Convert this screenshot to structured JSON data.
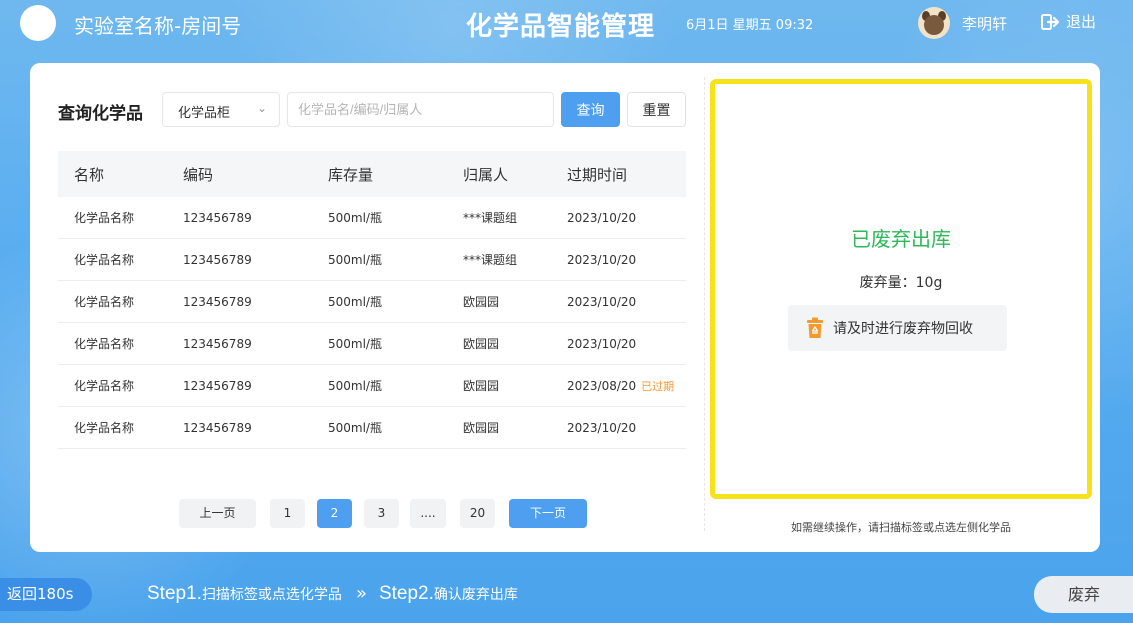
{
  "header": {
    "lab_name": "实验室名称-房间号",
    "title": "化学品智能管理",
    "datetime": "6月1日  星期五  09:32",
    "user_name": "李明轩",
    "logout_label": "退出"
  },
  "query": {
    "title": "查询化学品",
    "select_value": "化学品柜",
    "search_placeholder": "化学品名/编码/归属人",
    "query_label": "查询",
    "reset_label": "重置"
  },
  "table": {
    "headers": [
      "名称",
      "编码",
      "库存量",
      "归属人",
      "过期时间"
    ],
    "rows": [
      {
        "name": "化学品名称",
        "code": "123456789",
        "stock": "500ml/瓶",
        "owner": "***课题组",
        "expiry": "2023/10/20",
        "flag": ""
      },
      {
        "name": "化学品名称",
        "code": "123456789",
        "stock": "500ml/瓶",
        "owner": "***课题组",
        "expiry": "2023/10/20",
        "flag": ""
      },
      {
        "name": "化学品名称",
        "code": "123456789",
        "stock": "500ml/瓶",
        "owner": "欧园园",
        "expiry": "2023/10/20",
        "flag": ""
      },
      {
        "name": "化学品名称",
        "code": "123456789",
        "stock": "500ml/瓶",
        "owner": "欧园园",
        "expiry": "2023/10/20",
        "flag": ""
      },
      {
        "name": "化学品名称",
        "code": "123456789",
        "stock": "500ml/瓶",
        "owner": "欧园园",
        "expiry": "2023/08/20",
        "flag": "已过期"
      },
      {
        "name": "化学品名称",
        "code": "123456789",
        "stock": "500ml/瓶",
        "owner": "欧园园",
        "expiry": "2023/10/20",
        "flag": ""
      }
    ]
  },
  "pagination": {
    "prev_label": "上一页",
    "pages": [
      "1",
      "2",
      "3",
      "....",
      "20"
    ],
    "current": "2",
    "next_label": "下一页"
  },
  "result": {
    "status": "已废弃出库",
    "waste_label": "废弃量：",
    "waste_value": "10g",
    "recycle_label": "请及时进行废弃物回收",
    "hint": "如需继续操作，请扫描标签或点选左侧化学品"
  },
  "footer": {
    "back_label": "返回180s",
    "step1_no": "Step1.",
    "step1_text": "扫描标签或点选化学品",
    "arrow": "»",
    "step2_no": "Step2.",
    "step2_text": "确认废弃出库",
    "discard_label": "废弃"
  },
  "colors": {
    "accent": "#4e9ff0",
    "success": "#2fb85a",
    "warning": "#f39a2f",
    "highlight": "#f6e21a"
  }
}
